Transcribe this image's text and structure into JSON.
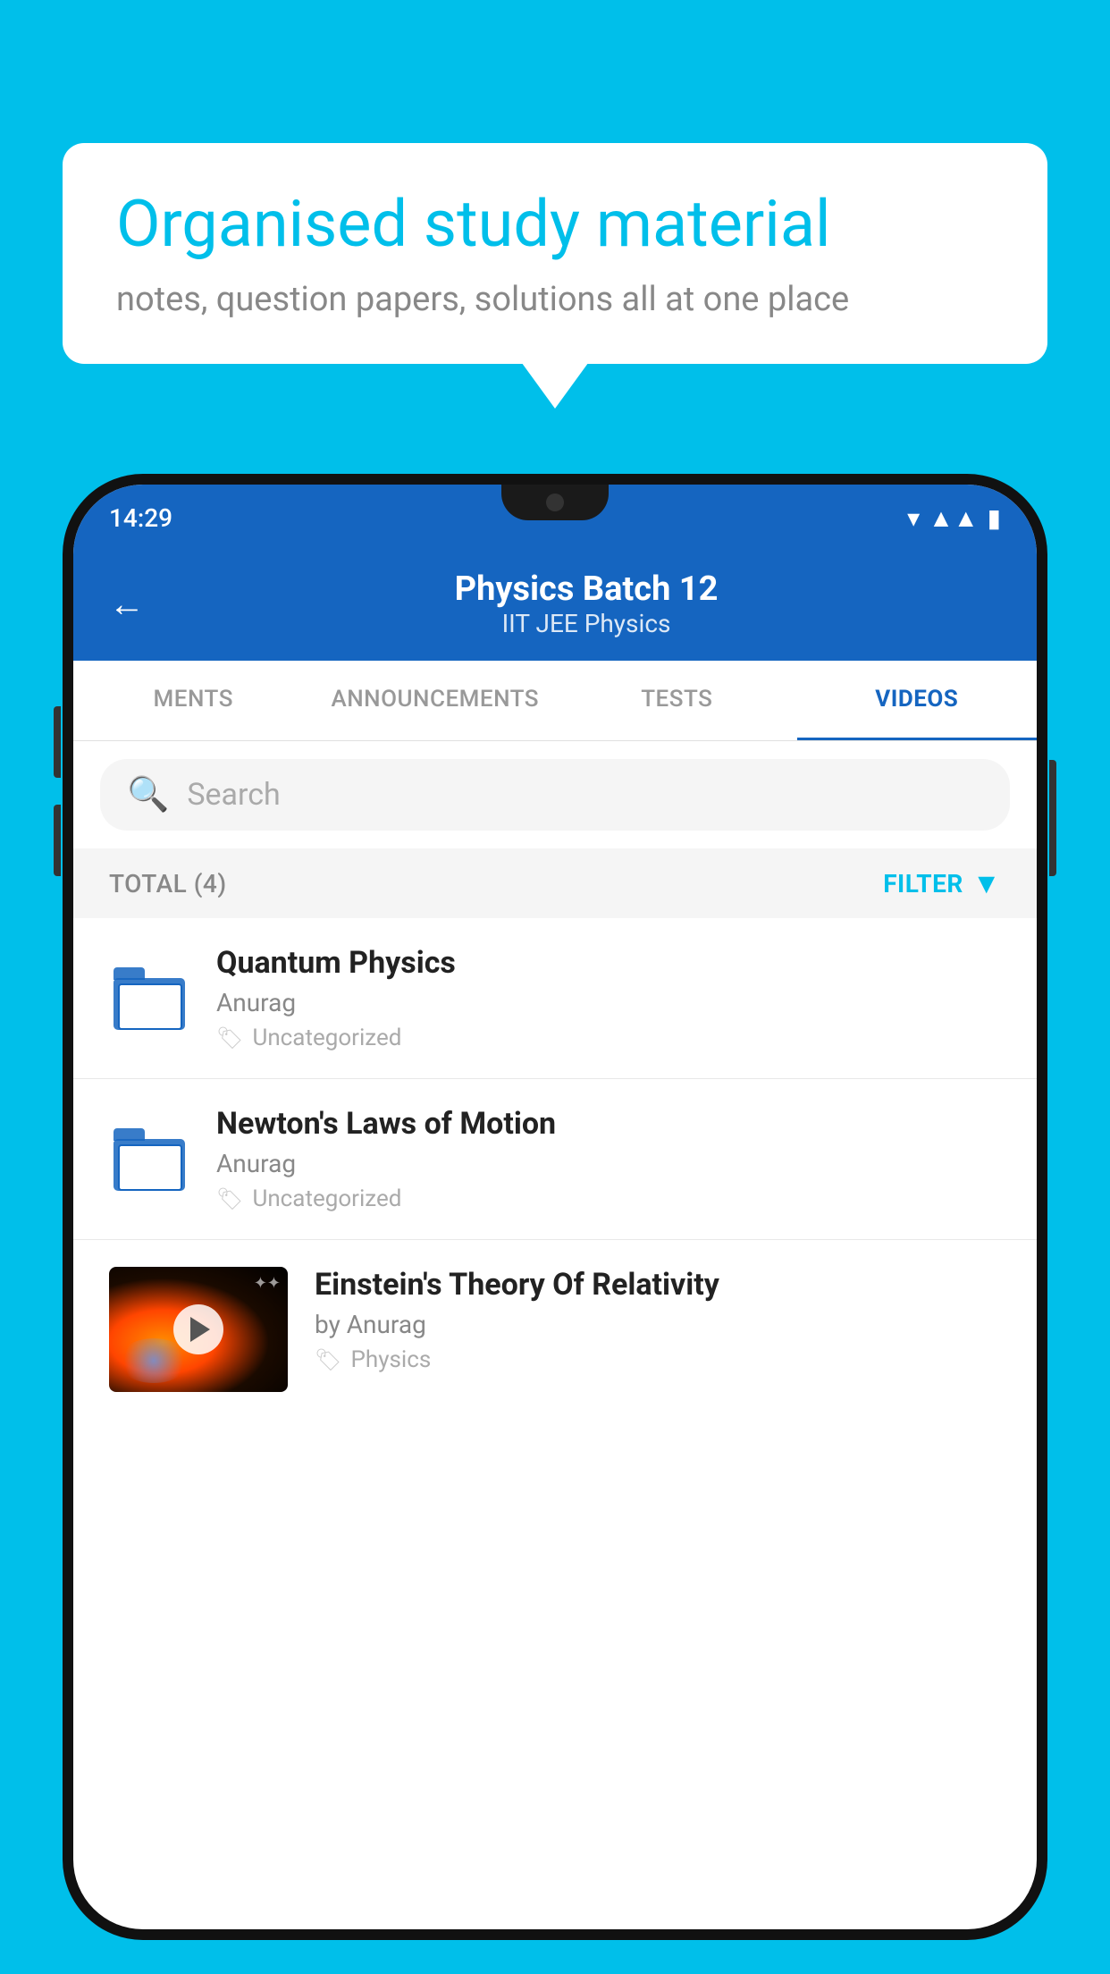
{
  "background_color": "#00BFEA",
  "speech_bubble": {
    "title": "Organised study material",
    "subtitle": "notes, question papers, solutions all at one place"
  },
  "phone": {
    "status_bar": {
      "time": "14:29"
    },
    "header": {
      "title": "Physics Batch 12",
      "subtitle": "IIT JEE   Physics",
      "back_label": "←"
    },
    "tabs": [
      {
        "label": "MENTS",
        "active": false
      },
      {
        "label": "ANNOUNCEMENTS",
        "active": false
      },
      {
        "label": "TESTS",
        "active": false
      },
      {
        "label": "VIDEOS",
        "active": true
      }
    ],
    "search": {
      "placeholder": "Search"
    },
    "filter": {
      "total_label": "TOTAL (4)",
      "filter_label": "FILTER"
    },
    "videos": [
      {
        "title": "Quantum Physics",
        "author": "Anurag",
        "tag": "Uncategorized",
        "has_thumbnail": false
      },
      {
        "title": "Newton's Laws of Motion",
        "author": "Anurag",
        "tag": "Uncategorized",
        "has_thumbnail": false
      },
      {
        "title": "Einstein's Theory Of Relativity",
        "author": "by Anurag",
        "tag": "Physics",
        "has_thumbnail": true
      }
    ]
  }
}
